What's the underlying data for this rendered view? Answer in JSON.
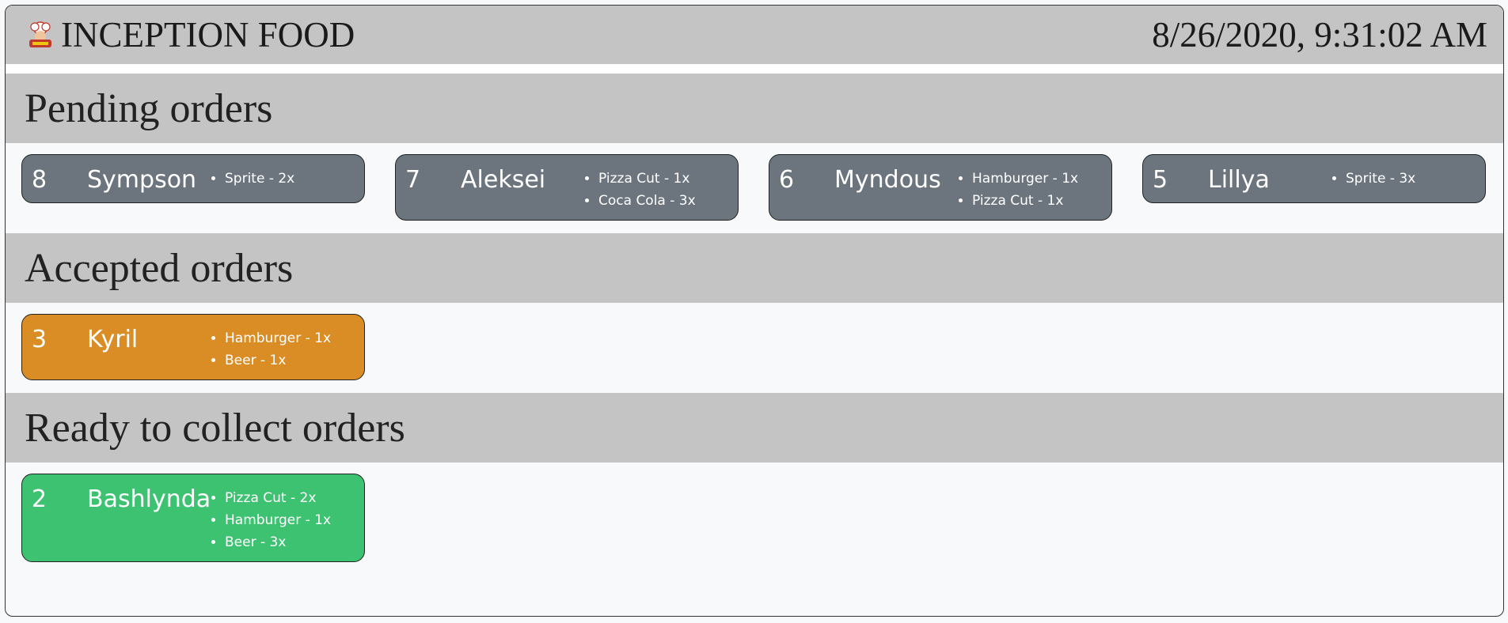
{
  "app": {
    "name": "INCEPTION FOOD",
    "datetime": "8/26/2020, 9:31:02 AM"
  },
  "sections": {
    "pending": {
      "title": "Pending orders",
      "orders": [
        {
          "number": "8",
          "name": "Sympson",
          "items": [
            "Sprite - 2x"
          ]
        },
        {
          "number": "7",
          "name": "Aleksei",
          "items": [
            "Pizza Cut - 1x",
            "Coca Cola - 3x"
          ]
        },
        {
          "number": "6",
          "name": "Myndous",
          "items": [
            "Hamburger - 1x",
            "Pizza Cut - 1x"
          ]
        },
        {
          "number": "5",
          "name": "Lillya",
          "items": [
            "Sprite - 3x"
          ]
        }
      ]
    },
    "accepted": {
      "title": "Accepted orders",
      "orders": [
        {
          "number": "3",
          "name": "Kyril",
          "items": [
            "Hamburger - 1x",
            "Beer - 1x"
          ]
        }
      ]
    },
    "ready": {
      "title": "Ready to collect orders",
      "orders": [
        {
          "number": "2",
          "name": "Bashlynda",
          "items": [
            "Pizza Cut - 2x",
            "Hamburger - 1x",
            "Beer - 3x"
          ]
        }
      ]
    }
  },
  "colors": {
    "pending": "#6c757d",
    "accepted": "#d98d24",
    "ready": "#3cc271",
    "band": "#c4c4c4"
  },
  "icons": {
    "logo": "chef-logo-icon"
  }
}
